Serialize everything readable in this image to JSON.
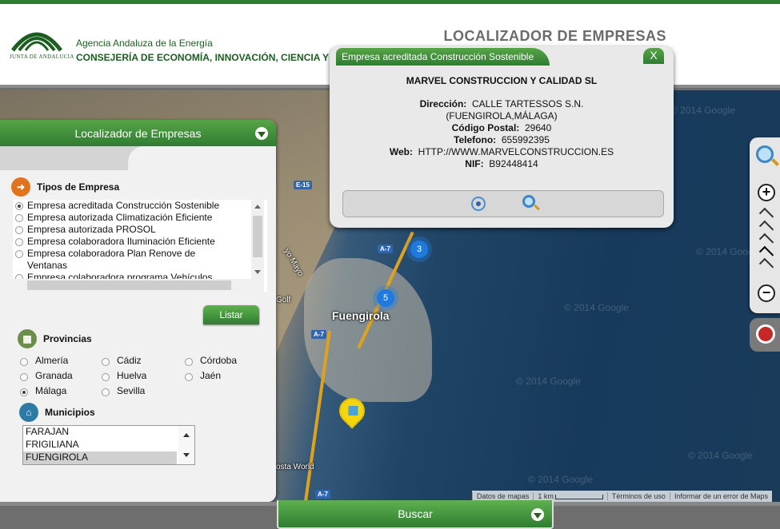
{
  "header": {
    "logo_text": "JUNTA DE ANDALUCIA",
    "agency": "Agencia Andaluza de la Energía",
    "consejeria": "CONSEJERÍA DE ECONOMÍA, INNOVACIÓN, CIENCIA Y EMPL",
    "app_title": "LOCALIZADOR DE EMPRESAS"
  },
  "left_panel": {
    "title": "Localizador de Empresas",
    "types_title": "Tipos de Empresa",
    "types": [
      {
        "label": "Empresa acreditada Construcción Sostenible",
        "selected": true
      },
      {
        "label": "Empresa autorizada Climatización Eficiente",
        "selected": false
      },
      {
        "label": "Empresa autorizada PROSOL",
        "selected": false
      },
      {
        "label": "Empresa colaboradora Iluminación Eficiente",
        "selected": false
      },
      {
        "label": "Empresa colaboradora Plan Renove de Ventanas",
        "selected": false
      },
      {
        "label": "Empresa colaboradora programa Vehículos",
        "selected": false
      }
    ],
    "listar_label": "Listar",
    "provinces_title": "Provincias",
    "provinces": [
      {
        "label": "Almería",
        "selected": false
      },
      {
        "label": "Cádiz",
        "selected": false
      },
      {
        "label": "Córdoba",
        "selected": false
      },
      {
        "label": "Granada",
        "selected": false
      },
      {
        "label": "Huelva",
        "selected": false
      },
      {
        "label": "Jaén",
        "selected": false
      },
      {
        "label": "Málaga",
        "selected": true
      },
      {
        "label": "Sevilla",
        "selected": false
      }
    ],
    "municipios_title": "Municipios",
    "municipios": [
      {
        "label": "FARAJAN",
        "selected": false
      },
      {
        "label": "FRIGILIANA",
        "selected": false
      },
      {
        "label": "FUENGIROLA",
        "selected": true
      }
    ]
  },
  "map": {
    "labels": {
      "city": "Fuengirola",
      "golf": "Golf",
      "costa": "osta World",
      "rio": "yo Mayo",
      "e15": "E-15",
      "a7a": "A-7",
      "a7b": "A-7",
      "a7c": "A-7"
    },
    "clusters": [
      {
        "count": "3"
      },
      {
        "count": "5"
      }
    ],
    "watermark": "© 2014 Google",
    "footer": {
      "datos": "Datos de mapas",
      "scale": "1 km",
      "terminos": "Términos de uso",
      "informar": "Informar de un error de Maps"
    }
  },
  "popup": {
    "tab_title": "Empresa acreditada Construcción Sostenible",
    "close_label": "X",
    "name": "MARVEL CONSTRUCCION Y CALIDAD SL",
    "direccion_label": "Dirección:",
    "direccion": "CALLE TARTESSOS S.N.",
    "localidad": "(FUENGIROLA,MÁLAGA)",
    "cp_label": "Código Postal:",
    "cp": "29640",
    "telefono_label": "Telefono:",
    "telefono": "655992395",
    "web_label": "Web:",
    "web": "HTTP://WWW.MARVELCONSTRUCCION.ES",
    "nif_label": "NIF:",
    "nif": "B92448414"
  },
  "bottom": {
    "buscar_label": "Buscar"
  },
  "colors": {
    "brand_green": "#2e7d32",
    "cluster_blue": "#1f7ae0",
    "pin_yellow": "#f4d60c"
  }
}
